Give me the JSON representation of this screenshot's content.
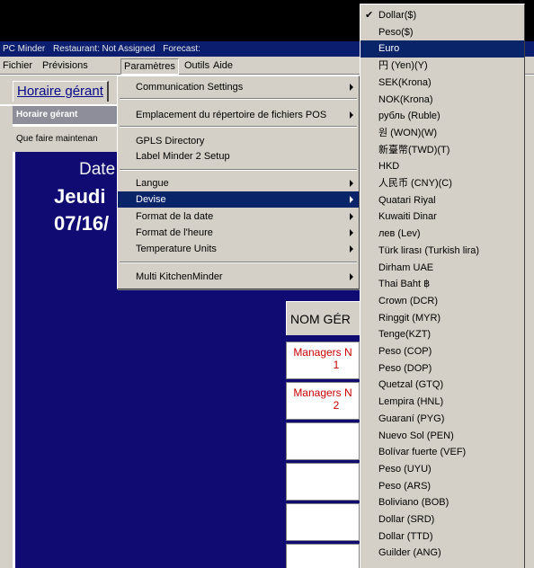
{
  "titlebar": {
    "app": "PC Minder",
    "restaurant": "Restaurant: Not Assigned",
    "forecast": "Forecast:"
  },
  "menubar": [
    {
      "label": "Fichier"
    },
    {
      "label": "Prévisions"
    },
    {
      "label": "Paramètres"
    },
    {
      "label": "Outils"
    },
    {
      "label": "Aide"
    }
  ],
  "tab": {
    "label": "Horaire gérant"
  },
  "section": {
    "title": "Horaire gérant"
  },
  "toolbar": {
    "prompt": "Que faire maintenan"
  },
  "main": {
    "date_label": "Date",
    "day": "Jeudi",
    "date": "07/16/"
  },
  "grid": {
    "header": "NOM GÉR",
    "rows": [
      {
        "name": "Managers N",
        "num": "1"
      },
      {
        "name": "Managers N",
        "num": "2"
      }
    ]
  },
  "params_menu": {
    "items": [
      {
        "label": "Communication Settings",
        "submenu": true
      },
      {
        "label": "Emplacement du répertoire de fichiers POS",
        "submenu": true
      },
      {
        "label": "GPLS Directory",
        "submenu": false
      },
      {
        "label": "Label Minder 2 Setup",
        "submenu": false
      },
      {
        "label": "Langue",
        "submenu": true
      },
      {
        "label": "Devise",
        "submenu": true,
        "highlighted": true
      },
      {
        "label": "Format de la date",
        "submenu": true
      },
      {
        "label": "Format de l'heure",
        "submenu": true
      },
      {
        "label": "Temperature Units",
        "submenu": true
      },
      {
        "label": "Multi KitchenMinder",
        "submenu": true
      }
    ]
  },
  "currency_menu": {
    "selected": "Dollar($)",
    "highlighted": "Euro",
    "items": [
      "Dollar($)",
      "Peso($)",
      "Euro",
      "円 (Yen)(Y)",
      "SEK(Krona)",
      "NOK(Krona)",
      "рубль (Ruble)",
      "원 (WON)(W)",
      "新臺幣(TWD)(T)",
      "HKD",
      "人民币 (CNY)(C)",
      "Quatari Riyal",
      "Kuwaiti Dinar",
      "лев (Lev)",
      "Türk lirası (Turkish lira)",
      "Dirham UAE",
      "Thai Baht ฿",
      "Crown (DCR)",
      "Ringgit (MYR)",
      "Tenge(KZT)",
      "Peso (COP)",
      "Peso (DOP)",
      "Quetzal (GTQ)",
      "Lempira (HNL)",
      "Guaraní (PYG)",
      "Nuevo Sol (PEN)",
      "Bolívar fuerte (VEF)",
      "Peso (UYU)",
      "Peso (ARS)",
      "Boliviano (BOB)",
      "Dollar (SRD)",
      "Dollar (TTD)",
      "Guilder (ANG)"
    ]
  },
  "colors": {
    "content_bg": "#0f0b72",
    "menu_highlight": "#0a246a",
    "manager_text": "#c80000"
  }
}
